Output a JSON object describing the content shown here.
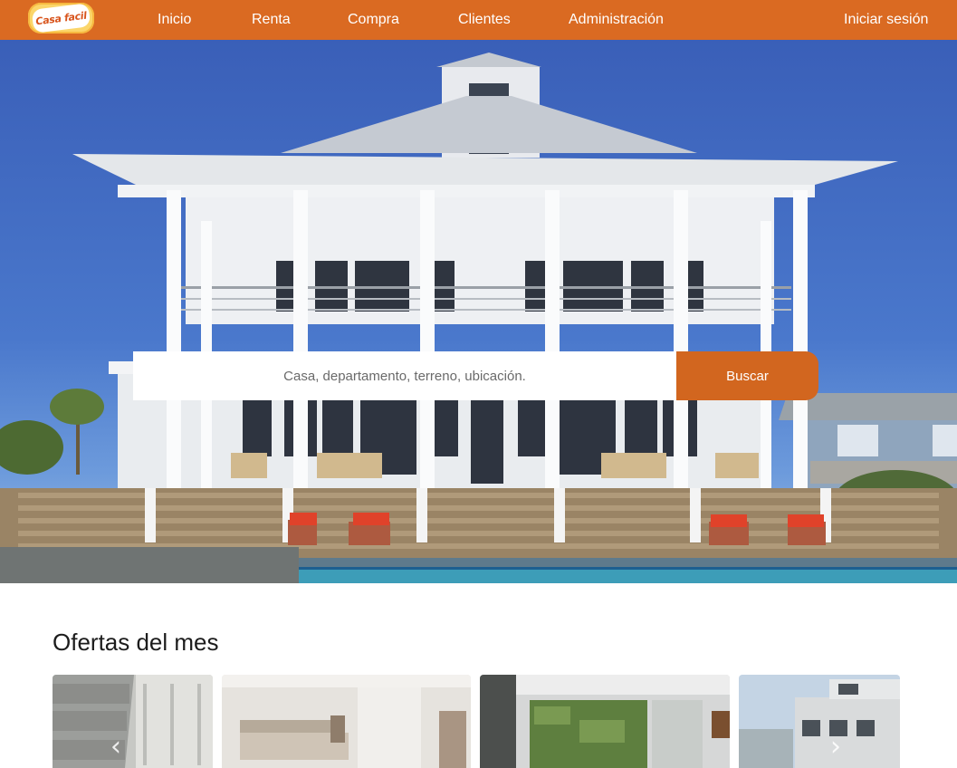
{
  "navbar": {
    "logo_text": "Casa facil",
    "links": [
      "Inicio",
      "Renta",
      "Compra",
      "Clientes",
      "Administración"
    ],
    "login": "Iniciar sesión"
  },
  "search": {
    "placeholder": "Casa, departamento, terreno, ubicación.",
    "button": "Buscar"
  },
  "offers": {
    "title": "Ofertas del mes",
    "prev_icon": "chevron-left-icon",
    "next_icon": "chevron-right-icon"
  },
  "colors": {
    "navbar": "#da6a22",
    "button": "#d2661f",
    "accent": "#fbd66a"
  }
}
